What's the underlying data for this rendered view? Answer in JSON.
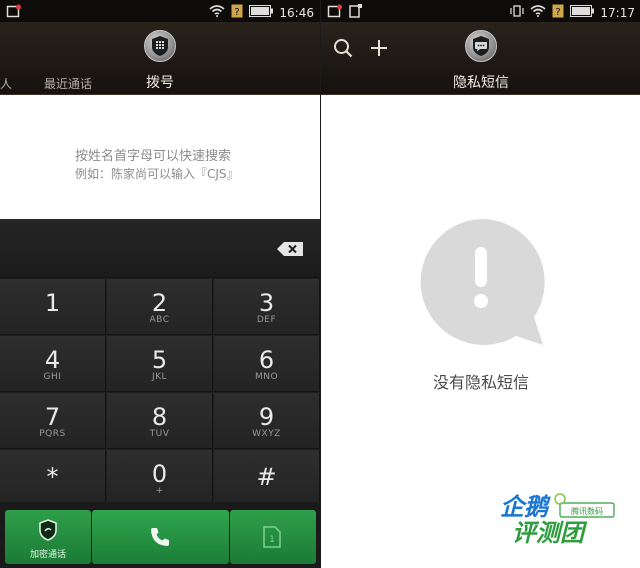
{
  "left": {
    "status": {
      "time": "16:46"
    },
    "header": {
      "title": "拨号",
      "left_tab": "最近通话",
      "edge_tab": "人"
    },
    "hint": {
      "line1": "按姓名首字母可以快速搜索",
      "line2": "例如：陈家尚可以输入『CJS』"
    },
    "keypad": {
      "keys": [
        {
          "digit": "1",
          "letters": ""
        },
        {
          "digit": "2",
          "letters": "ABC"
        },
        {
          "digit": "3",
          "letters": "DEF"
        },
        {
          "digit": "4",
          "letters": "GHI"
        },
        {
          "digit": "5",
          "letters": "JKL"
        },
        {
          "digit": "6",
          "letters": "MNO"
        },
        {
          "digit": "7",
          "letters": "PQRS"
        },
        {
          "digit": "8",
          "letters": "TUV"
        },
        {
          "digit": "9",
          "letters": "WXYZ"
        },
        {
          "digit": "*",
          "letters": ""
        },
        {
          "digit": "0",
          "letters": "+"
        },
        {
          "digit": "#",
          "letters": ""
        }
      ]
    },
    "actions": {
      "secure_label": "加密通话"
    }
  },
  "right": {
    "status": {
      "time": "17:17"
    },
    "header": {
      "title": "隐私短信"
    },
    "empty": {
      "text": "没有隐私短信"
    }
  },
  "watermark": {
    "line1": "企鹅",
    "line2": "评测团",
    "badge": "腾讯数码"
  },
  "colors": {
    "accent_green": "#1f8a3d",
    "header_dark": "#1e1915"
  }
}
